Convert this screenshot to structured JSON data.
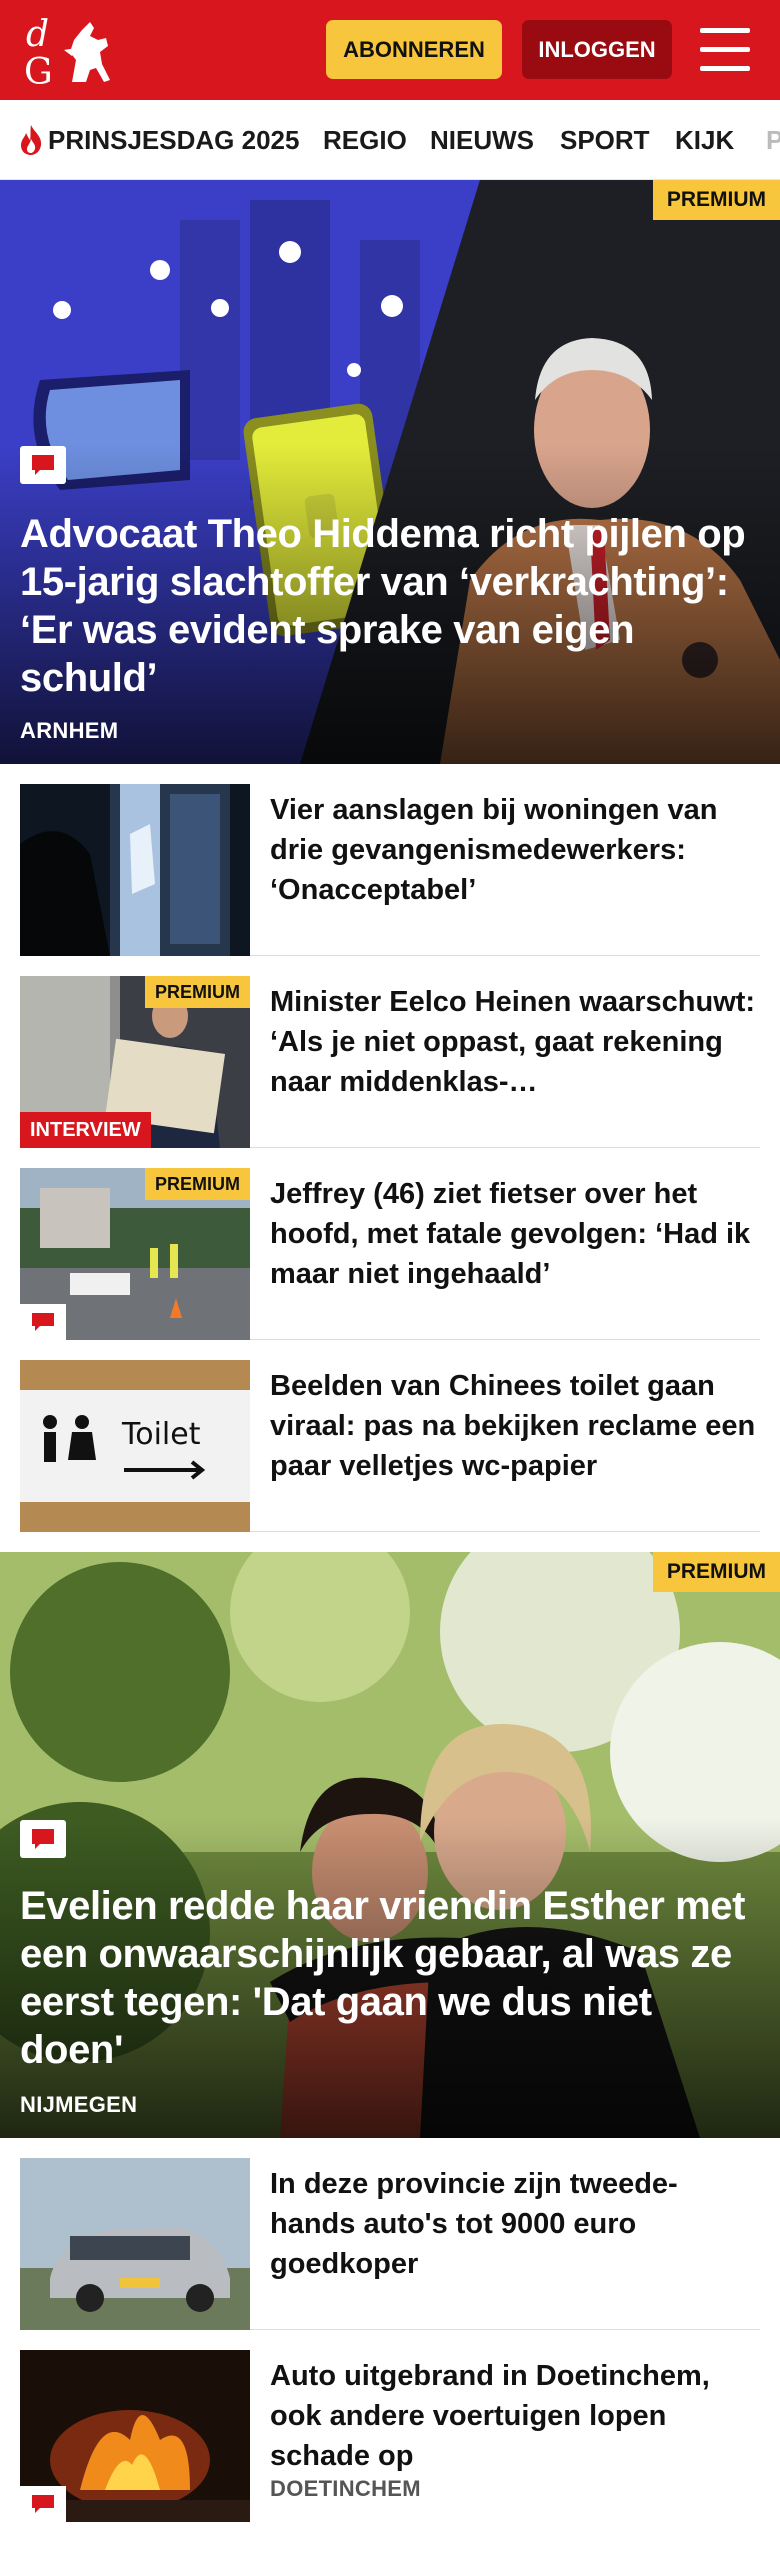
{
  "header": {
    "logo_text": "dG",
    "subscribe_label": "ABONNEREN",
    "login_label": "INLOGGEN",
    "menu_icon": "hamburger-icon",
    "brand_color": "#d7161d"
  },
  "nav": {
    "items": [
      {
        "label": "PRINSJESDAG 2025",
        "icon": "flame-icon"
      },
      {
        "label": "REGIO"
      },
      {
        "label": "NIEUWS"
      },
      {
        "label": "SPORT"
      },
      {
        "label": "KIJK"
      },
      {
        "label": "P"
      }
    ]
  },
  "hero1": {
    "badge": "PREMIUM",
    "title": "Advocaat Theo Hiddema richt pijlen op 15-jarig slachtoffer van ‘verkrachting’: ‘Er was evident sprake van eigen schuld’",
    "location": "ARNHEM",
    "comment_icon": "comment-icon"
  },
  "articles": [
    {
      "title": "Vier aanslagen bij woningen van drie gevangenismedewerkers: ‘Onacceptabel’"
    },
    {
      "badge": "PREMIUM",
      "label": "INTERVIEW",
      "title": "Minister Eelco Heinen waarschuwt: ‘Als je niet oppast, gaat rekening naar middenklas-…"
    },
    {
      "badge": "PREMIUM",
      "title": "Jeffrey (46) ziet fietser over het hoofd, met fatale gevolgen: ‘Had ik maar niet ingehaald’",
      "comment_icon": "comment-icon"
    },
    {
      "title": "Beelden van Chinees toilet gaan viraal: pas na bekijken reclame een paar velletjes wc-papier",
      "thumb_text": "Toilet"
    }
  ],
  "hero2": {
    "badge": "PREMIUM",
    "title": "Evelien redde haar vriendin Esther met een onwaarschijnlijk gebaar, al was ze eerst tegen: 'Dat gaan we dus niet doen'",
    "location": "NIJMEGEN",
    "comment_icon": "comment-icon"
  },
  "articles2": [
    {
      "title": "In deze provincie zijn tweede-hands auto's tot 9000 euro goedkoper"
    },
    {
      "title": "Auto uitgebrand in Doetinchem, ook andere voertuigen lopen schade op",
      "location": "DOETINCHEM",
      "comment_icon": "comment-icon"
    }
  ]
}
